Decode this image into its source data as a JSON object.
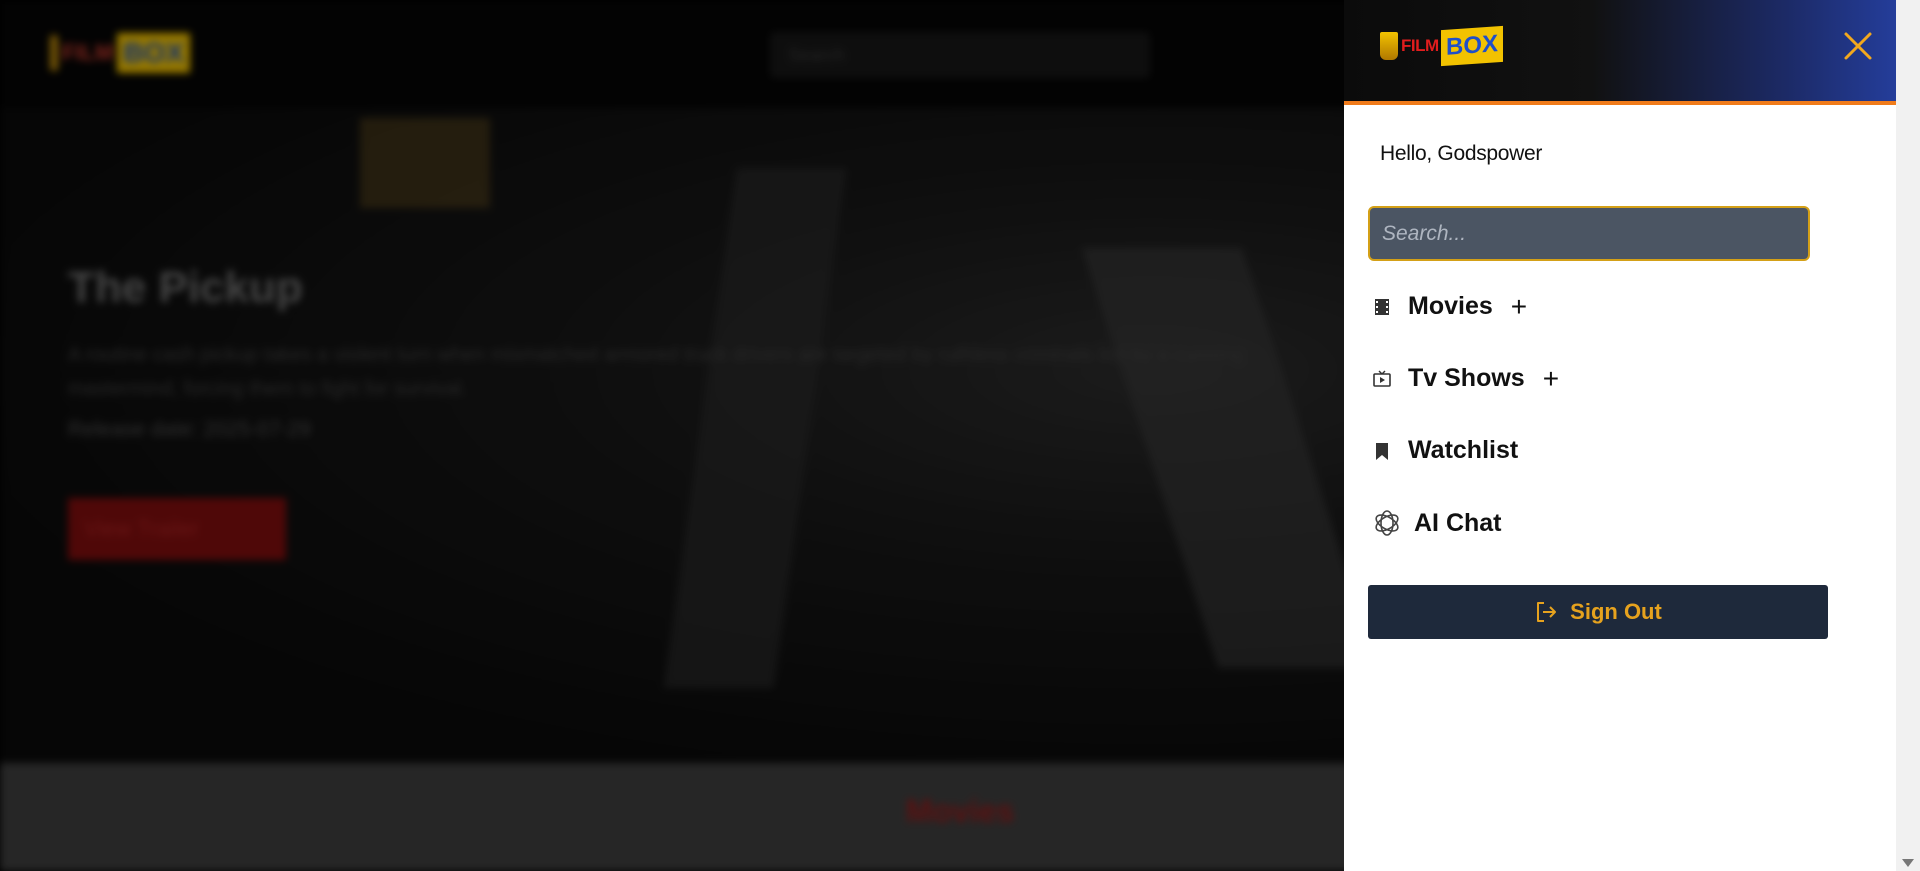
{
  "background": {
    "header": {
      "logo": {
        "film": "FILM",
        "box": "BOX"
      },
      "search_placeholder": "Search"
    },
    "hero": {
      "title": "The Pickup",
      "description": "A routine cash pickup takes a violent turn when mismatched armored truck drivers are targeted by ruthless criminals led by a cunning mastermind, forcing them to fight for survival.",
      "release": "Release date: 2025-07-29",
      "trailer_button": "View Trailer"
    },
    "section_title": "Movies"
  },
  "drawer": {
    "logo": {
      "film": "FILM",
      "box": "BOX"
    },
    "greeting": "Hello, Godspower",
    "search_placeholder": "Search...",
    "nav": [
      {
        "label": "Movies",
        "icon": "film-icon",
        "expandable": true
      },
      {
        "label": "Tv Shows",
        "icon": "tv-icon",
        "expandable": true
      },
      {
        "label": "Watchlist",
        "icon": "bookmark-icon",
        "expandable": false
      },
      {
        "label": "AI Chat",
        "icon": "openai-icon",
        "expandable": false
      }
    ],
    "expand_symbol": "+",
    "sign_out": "Sign Out"
  },
  "colors": {
    "accent_gold": "#e6a21e",
    "header_border": "#f07b1a",
    "signout_bg": "#1e293b",
    "search_bg": "#4b5563",
    "close_icon": "#f2a81d"
  }
}
